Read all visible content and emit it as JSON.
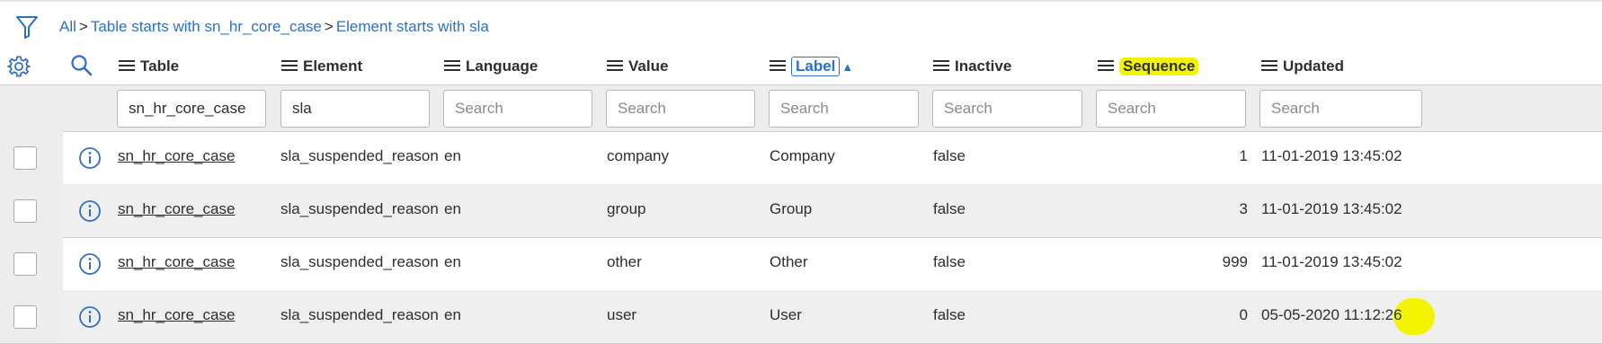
{
  "breadcrumb": {
    "all": "All",
    "separator": ">",
    "table_filter": "Table starts with sn_hr_core_case",
    "element_filter": "Element starts with sla"
  },
  "columns": {
    "table": "Table",
    "element": "Element",
    "language": "Language",
    "value": "Value",
    "label": "Label",
    "inactive": "Inactive",
    "sequence": "Sequence",
    "updated": "Updated"
  },
  "sort": {
    "column": "Label",
    "direction": "ascending"
  },
  "filters": {
    "table_value": "sn_hr_core_case",
    "element_value": "sla",
    "placeholder": "Search"
  },
  "rows": [
    {
      "table": "sn_hr_core_case",
      "element": "sla_suspended_reason",
      "language": "en",
      "value": "company",
      "label": "Company",
      "inactive": "false",
      "sequence": "1",
      "updated": "11-01-2019 13:45:02"
    },
    {
      "table": "sn_hr_core_case",
      "element": "sla_suspended_reason",
      "language": "en",
      "value": "group",
      "label": "Group",
      "inactive": "false",
      "sequence": "3",
      "updated": "11-01-2019 13:45:02"
    },
    {
      "table": "sn_hr_core_case",
      "element": "sla_suspended_reason",
      "language": "en",
      "value": "other",
      "label": "Other",
      "inactive": "false",
      "sequence": "999",
      "updated": "11-01-2019 13:45:02"
    },
    {
      "table": "sn_hr_core_case",
      "element": "sla_suspended_reason",
      "language": "en",
      "value": "user",
      "label": "User",
      "inactive": "false",
      "sequence": "0",
      "updated": "05-05-2020 11:12:26"
    }
  ],
  "icons": {
    "filter": "filter-funnel-icon",
    "settings": "gear-icon",
    "search": "search-icon",
    "column_menu": "hamburger-menu-icon",
    "info": "info-icon"
  },
  "colors": {
    "link": "#2e6fc4",
    "highlight": "#f3f400",
    "band": "#ededed"
  }
}
